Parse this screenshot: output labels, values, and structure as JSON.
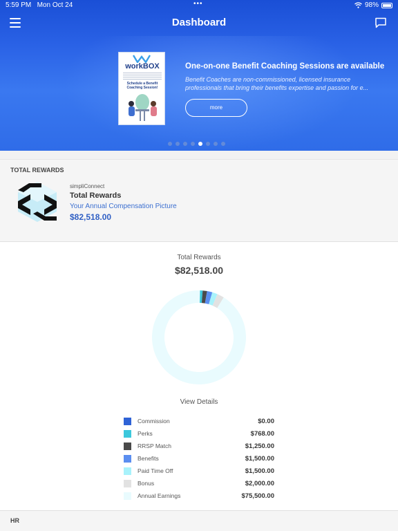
{
  "status_bar": {
    "time": "5:59 PM",
    "date": "Mon Oct 24",
    "battery": "98%"
  },
  "nav": {
    "title": "Dashboard",
    "menu_icon": "hamburger-menu-icon",
    "chat_icon": "chat-bubble-icon"
  },
  "banner": {
    "poster_brand": "workBOX",
    "poster_subtitle": "Schedule a Benefit Coaching Session!",
    "title": "One-on-one Benefit Coaching Sessions are available",
    "description_line1": "Benefit Coaches are non-commissioned, licensed insurance",
    "description_line2": "professionals that bring their benefits expertise and passion for e...",
    "more_label": "more",
    "pages": 8,
    "active_page": 5
  },
  "total_rewards_card": {
    "section_title": "TOTAL REWARDS",
    "provider": "simpliConnect",
    "name": "Total Rewards",
    "description": "Your Annual Compensation Picture",
    "amount": "$82,518.00"
  },
  "chart_panel": {
    "label": "Total Rewards",
    "total": "$82,518.00",
    "view_details": "View Details"
  },
  "chart_data": {
    "type": "pie",
    "donut": true,
    "categories": [
      "Commission",
      "Perks",
      "RRSP Match",
      "Benefits",
      "Paid Time Off",
      "Bonus",
      "Annual Earnings"
    ],
    "values": [
      0,
      768,
      1250,
      1500,
      1500,
      2000,
      75500
    ],
    "value_labels": [
      "$0.00",
      "$768.00",
      "$1,250.00",
      "$1,500.00",
      "$1,500.00",
      "$2,000.00",
      "$75,500.00"
    ],
    "colors": [
      "#2f63d6",
      "#3cc8dc",
      "#4a4a4a",
      "#5b8ef0",
      "#a8f2fb",
      "#e2e2e2",
      "#e9fbfe"
    ],
    "legend": "below"
  },
  "hr_section": {
    "title": "HR"
  }
}
